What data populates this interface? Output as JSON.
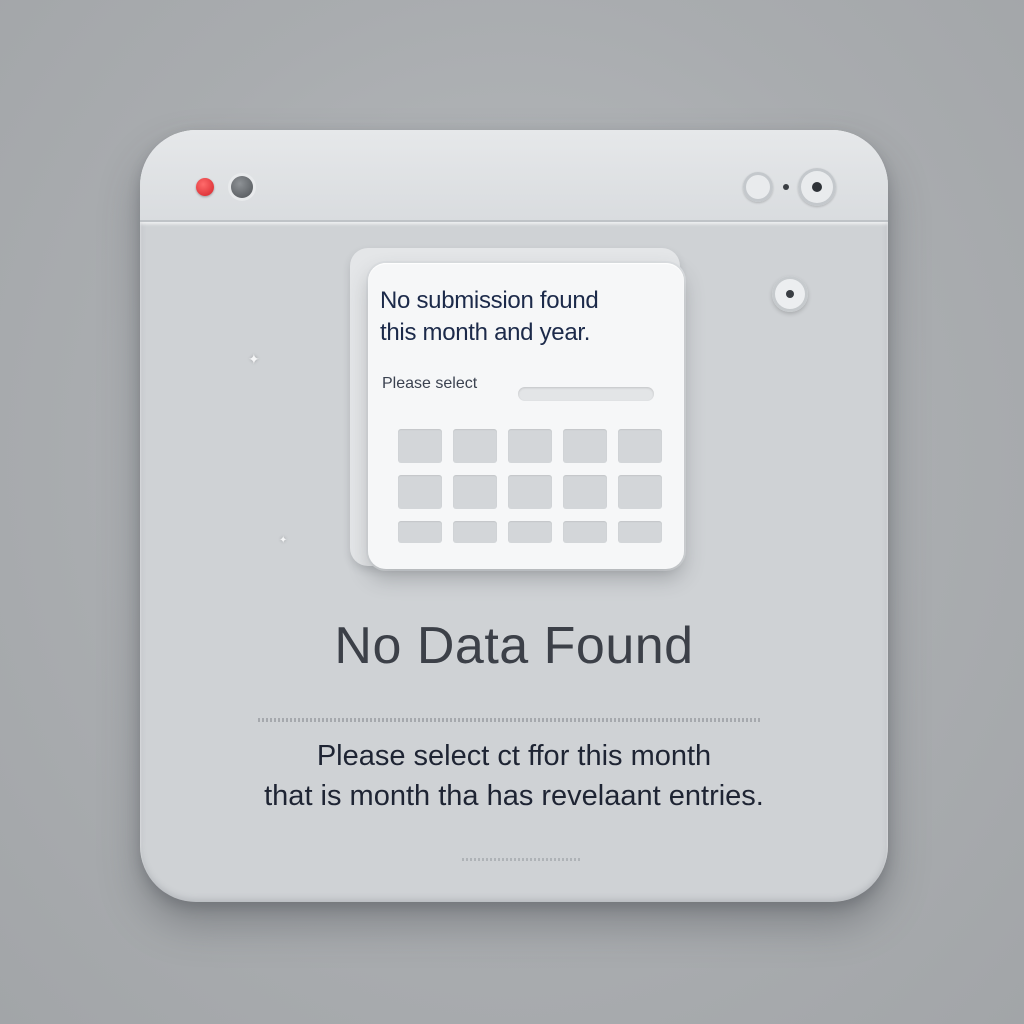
{
  "dialog": {
    "card": {
      "title_line1": "No submission found",
      "title_line2": "this month and year.",
      "prompt": "Please select"
    },
    "heading": "No Data Found",
    "message_line1": "Please select ct ffor this month",
    "message_line2": "that is month tha has revelaant entries."
  },
  "icons": {
    "close": "red-dot-icon",
    "minimize": "gray-dot-icon",
    "window_controls": [
      "circle-icon",
      "circle-dot-icon"
    ],
    "options": "circle-dot-icon",
    "calendar": "calendar-grid-icon"
  },
  "colors": {
    "close_red": "#d4242b",
    "text_dark": "#1e2433",
    "heading": "#3c4048",
    "window_bg": "#cfd2d5"
  }
}
